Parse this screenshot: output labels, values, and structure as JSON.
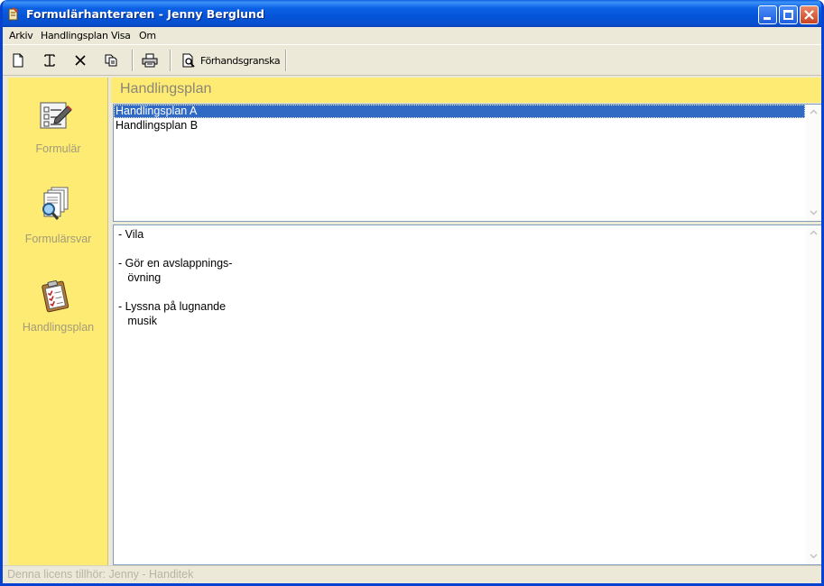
{
  "window": {
    "title": "Formulärhanteraren - Jenny Berglund"
  },
  "menu": [
    {
      "label": "Arkiv"
    },
    {
      "label": "Handlingsplan"
    },
    {
      "label": "Visa"
    },
    {
      "label": "Om"
    }
  ],
  "toolbar": {
    "new_icon": "new-document-icon",
    "rename_icon": "text-cursor-icon",
    "delete_icon": "delete-x-icon",
    "copy_icon": "copy-icon",
    "print_icon": "printer-icon",
    "preview_label": "Förhandsgranska"
  },
  "sidebar": {
    "background": "#fdeb74",
    "items": [
      {
        "label": "Formulär",
        "icon": "form-checklist-icon"
      },
      {
        "label": "Formulärsvar",
        "icon": "magnifier-document-icon"
      },
      {
        "label": "Handlingsplan",
        "icon": "clipboard-checklist-icon"
      }
    ]
  },
  "section": {
    "title": "Handlingsplan"
  },
  "plans": {
    "items": [
      {
        "label": "Handlingsplan A",
        "selected": true
      },
      {
        "label": "Handlingsplan B",
        "selected": false
      }
    ],
    "selection_color": "#316ac5"
  },
  "plan_text": "- Vila\n\n- Gör en avslappnings-\n   övning\n\n- Lyssna på lugnande\n   musik",
  "status": {
    "text": "Denna licens tillhör: Jenny - Handitek"
  }
}
